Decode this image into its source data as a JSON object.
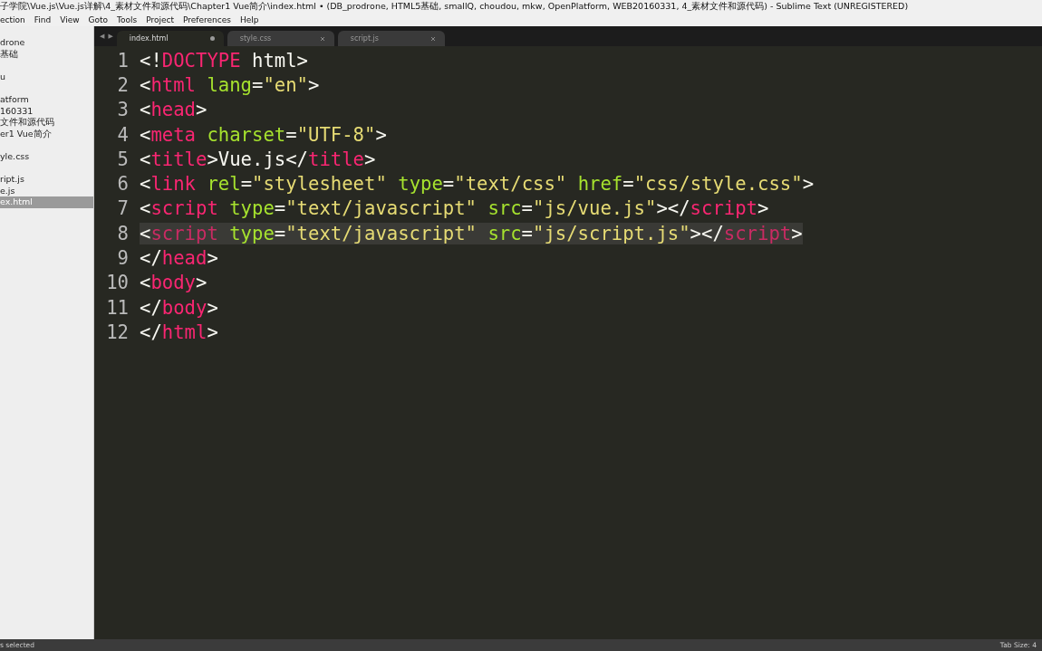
{
  "window": {
    "title": "子学院\\Vue.js\\Vue.js详解\\4_素材文件和源代码\\Chapter1 Vue简介\\index.html • (DB_prodrone, HTML5基础, smallQ, choudou, mkw, OpenPlatform, WEB20160331, 4_素材文件和源代码) - Sublime Text (UNREGISTERED)"
  },
  "menu": [
    "ection",
    "Find",
    "View",
    "Goto",
    "Tools",
    "Project",
    "Preferences",
    "Help"
  ],
  "sidebar": {
    "items": [
      {
        "label": "drone",
        "gap_before": false,
        "selected": false
      },
      {
        "label": "基础",
        "gap_before": false,
        "selected": false
      },
      {
        "label": "u",
        "gap_before": true,
        "selected": false
      },
      {
        "label": "atform",
        "gap_before": true,
        "selected": false
      },
      {
        "label": "160331",
        "gap_before": false,
        "selected": false
      },
      {
        "label": "文件和源代码",
        "gap_before": false,
        "selected": false
      },
      {
        "label": "er1 Vue简介",
        "gap_before": false,
        "selected": false
      },
      {
        "label": "yle.css",
        "gap_before": true,
        "selected": false
      },
      {
        "label": "ript.js",
        "gap_before": true,
        "selected": false
      },
      {
        "label": "e.js",
        "gap_before": false,
        "selected": false
      },
      {
        "label": "ex.html",
        "gap_before": false,
        "selected": true
      }
    ]
  },
  "tab_nav": [
    "◀",
    "▶"
  ],
  "tabs": [
    {
      "label": "index.html",
      "selected": true,
      "modified": true
    },
    {
      "label": "style.css",
      "selected": false,
      "modified": false
    },
    {
      "label": "script.js",
      "selected": false,
      "modified": false
    }
  ],
  "editor": {
    "lines": [
      {
        "number": "1",
        "selected": false,
        "tokens": [
          {
            "kind": "plain",
            "text": "<!"
          },
          {
            "kind": "tag",
            "text": "DOCTYPE"
          },
          {
            "kind": "plain",
            "text": " html>"
          }
        ]
      },
      {
        "number": "2",
        "selected": false,
        "tokens": [
          {
            "kind": "plain",
            "text": "<"
          },
          {
            "kind": "tag",
            "text": "html"
          },
          {
            "kind": "attr",
            "text": " lang"
          },
          {
            "kind": "plain",
            "text": "="
          },
          {
            "kind": "string",
            "text": "\"en\""
          },
          {
            "kind": "plain",
            "text": ">"
          }
        ]
      },
      {
        "number": "3",
        "selected": false,
        "tokens": [
          {
            "kind": "plain",
            "text": "<"
          },
          {
            "kind": "tag",
            "text": "head"
          },
          {
            "kind": "plain",
            "text": ">"
          }
        ]
      },
      {
        "number": "4",
        "selected": false,
        "tokens": [
          {
            "kind": "plain",
            "text": "<"
          },
          {
            "kind": "tag",
            "text": "meta"
          },
          {
            "kind": "attr",
            "text": " charset"
          },
          {
            "kind": "plain",
            "text": "="
          },
          {
            "kind": "string",
            "text": "\"UTF-8\""
          },
          {
            "kind": "plain",
            "text": ">"
          }
        ]
      },
      {
        "number": "5",
        "selected": false,
        "tokens": [
          {
            "kind": "plain",
            "text": "<"
          },
          {
            "kind": "tag",
            "text": "title"
          },
          {
            "kind": "plain",
            "text": ">Vue.js</"
          },
          {
            "kind": "tag",
            "text": "title"
          },
          {
            "kind": "plain",
            "text": ">"
          }
        ]
      },
      {
        "number": "6",
        "selected": false,
        "tokens": [
          {
            "kind": "plain",
            "text": "<"
          },
          {
            "kind": "tag",
            "text": "link"
          },
          {
            "kind": "attr",
            "text": " rel"
          },
          {
            "kind": "plain",
            "text": "="
          },
          {
            "kind": "string",
            "text": "\"stylesheet\""
          },
          {
            "kind": "attr",
            "text": " type"
          },
          {
            "kind": "plain",
            "text": "="
          },
          {
            "kind": "string",
            "text": "\"text/css\""
          },
          {
            "kind": "attr",
            "text": " href"
          },
          {
            "kind": "plain",
            "text": "="
          },
          {
            "kind": "string",
            "text": "\"css/style.css\""
          },
          {
            "kind": "plain",
            "text": ">"
          }
        ]
      },
      {
        "number": "7",
        "selected": false,
        "tokens": [
          {
            "kind": "plain",
            "text": "<"
          },
          {
            "kind": "tag",
            "text": "script"
          },
          {
            "kind": "attr",
            "text": " type"
          },
          {
            "kind": "plain",
            "text": "="
          },
          {
            "kind": "string",
            "text": "\"text/javascript\""
          },
          {
            "kind": "attr",
            "text": " src"
          },
          {
            "kind": "plain",
            "text": "="
          },
          {
            "kind": "string",
            "text": "\"js/vue.js\""
          },
          {
            "kind": "plain",
            "text": "></"
          },
          {
            "kind": "tag",
            "text": "script"
          },
          {
            "kind": "plain",
            "text": ">"
          }
        ]
      },
      {
        "number": "8",
        "selected": true,
        "tokens": [
          {
            "kind": "plain",
            "text": "<"
          },
          {
            "kind": "tag",
            "text": "script"
          },
          {
            "kind": "attr",
            "text": " type"
          },
          {
            "kind": "plain",
            "text": "="
          },
          {
            "kind": "string",
            "text": "\"text/javascript\""
          },
          {
            "kind": "attr",
            "text": " src"
          },
          {
            "kind": "plain",
            "text": "="
          },
          {
            "kind": "string",
            "text": "\"js/script.js\""
          },
          {
            "kind": "plain",
            "text": "></"
          },
          {
            "kind": "tag",
            "text": "script"
          },
          {
            "kind": "plain",
            "text": ">"
          }
        ]
      },
      {
        "number": "9",
        "selected": false,
        "tokens": [
          {
            "kind": "plain",
            "text": "</"
          },
          {
            "kind": "tag",
            "text": "head"
          },
          {
            "kind": "plain",
            "text": ">"
          }
        ]
      },
      {
        "number": "10",
        "selected": false,
        "tokens": [
          {
            "kind": "plain",
            "text": "<"
          },
          {
            "kind": "tag",
            "text": "body"
          },
          {
            "kind": "plain",
            "text": ">"
          }
        ]
      },
      {
        "number": "11",
        "selected": false,
        "tokens": [
          {
            "kind": "plain",
            "text": "</"
          },
          {
            "kind": "tag",
            "text": "body"
          },
          {
            "kind": "plain",
            "text": ">"
          }
        ]
      },
      {
        "number": "12",
        "selected": false,
        "tokens": [
          {
            "kind": "plain",
            "text": "</"
          },
          {
            "kind": "tag",
            "text": "html"
          },
          {
            "kind": "plain",
            "text": ">"
          }
        ]
      }
    ]
  },
  "status_bar": {
    "left": "s selected",
    "right": "Tab Size: 4"
  }
}
